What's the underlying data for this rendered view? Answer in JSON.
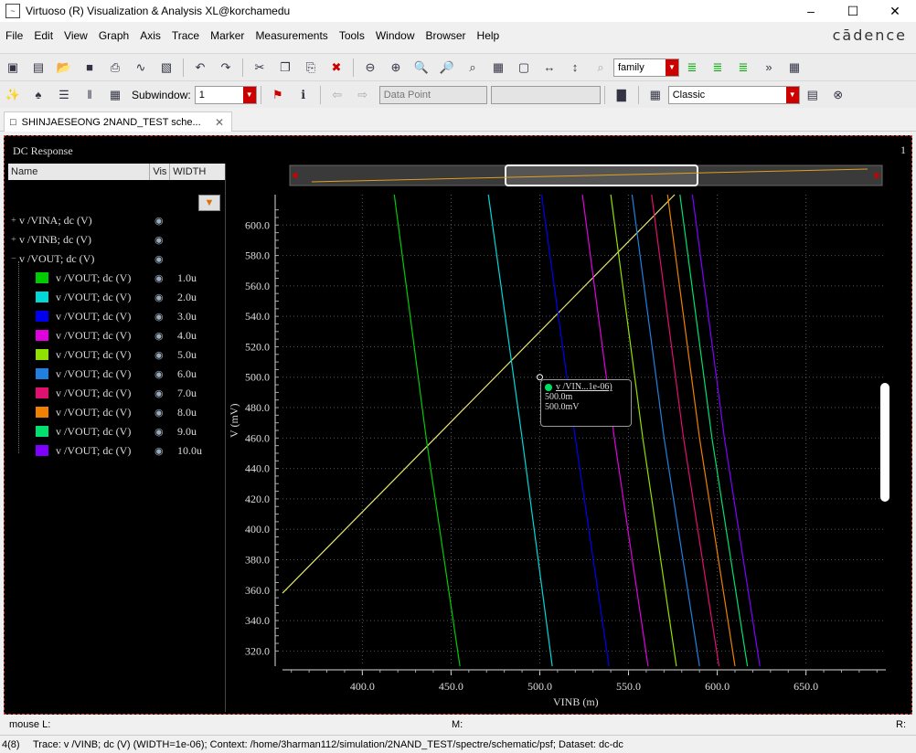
{
  "window": {
    "title": "Virtuoso (R) Visualization & Analysis XL@korchamedu"
  },
  "menu": [
    "File",
    "Edit",
    "View",
    "Graph",
    "Axis",
    "Trace",
    "Marker",
    "Measurements",
    "Tools",
    "Window",
    "Browser",
    "Help"
  ],
  "logo": "cādence",
  "toolbar": {
    "family_value": "family",
    "subwindow_label": "Subwindow:",
    "subwindow_value": "1",
    "data_point_placeholder": "Data Point",
    "style_value": "Classic"
  },
  "tab": {
    "label": "SHINJAESEONG 2NAND_TEST sche..."
  },
  "plot": {
    "title": "DC Response",
    "subwindow_number": "1",
    "ylabel": "V (mV)",
    "xlabel": "VINB (m)"
  },
  "tree": {
    "headers": {
      "name": "Name",
      "vis": "Vis",
      "width": "WIDTH"
    },
    "items": [
      {
        "label": "v /VINA; dc (V)",
        "expander": "+",
        "width": "",
        "color": ""
      },
      {
        "label": "v /VINB; dc (V)",
        "expander": "+",
        "width": "",
        "color": ""
      },
      {
        "label": "v /VOUT; dc (V)",
        "expander": "−",
        "width": "",
        "color": ""
      },
      {
        "label": "v /VOUT; dc (V)",
        "width": "1.0u",
        "color": "#00cc00"
      },
      {
        "label": "v /VOUT; dc (V)",
        "width": "2.0u",
        "color": "#00d8d8"
      },
      {
        "label": "v /VOUT; dc (V)",
        "width": "3.0u",
        "color": "#0000ee"
      },
      {
        "label": "v /VOUT; dc (V)",
        "width": "4.0u",
        "color": "#e000e0"
      },
      {
        "label": "v /VOUT; dc (V)",
        "width": "5.0u",
        "color": "#90e000"
      },
      {
        "label": "v /VOUT; dc (V)",
        "width": "6.0u",
        "color": "#2080e0"
      },
      {
        "label": "v /VOUT; dc (V)",
        "width": "7.0u",
        "color": "#e01070"
      },
      {
        "label": "v /VOUT; dc (V)",
        "width": "8.0u",
        "color": "#f08000"
      },
      {
        "label": "v /VOUT; dc (V)",
        "width": "9.0u",
        "color": "#00e070"
      },
      {
        "label": "v /VOUT; dc (V)",
        "width": "10.0u",
        "color": "#8000ff"
      }
    ]
  },
  "tooltip": {
    "title": "v /VIN...1e-06)",
    "x": "500.0m",
    "y": "500.0mV"
  },
  "chart_data": {
    "type": "line",
    "xlabel": "VINB (m)",
    "ylabel": "V (mV)",
    "xlim": [
      355,
      695
    ],
    "ylim": [
      310,
      620
    ],
    "xticks": [
      400,
      450,
      500,
      550,
      600,
      650
    ],
    "yticks": [
      320,
      340,
      360,
      380,
      400,
      420,
      440,
      460,
      480,
      500,
      520,
      540,
      560,
      580,
      600
    ],
    "series": [
      {
        "name": "v /VINB; dc (V)",
        "color": "#e8e870",
        "points": [
          [
            355,
            358
          ],
          [
            576,
            620
          ]
        ]
      },
      {
        "name": "1.0u",
        "color": "#00cc00",
        "points": [
          [
            418,
            620
          ],
          [
            436,
            460
          ],
          [
            455,
            310
          ]
        ]
      },
      {
        "name": "2.0u",
        "color": "#00d8d8",
        "points": [
          [
            471,
            620
          ],
          [
            490,
            460
          ],
          [
            507,
            310
          ]
        ]
      },
      {
        "name": "3.0u",
        "color": "#0000ee",
        "points": [
          [
            501,
            620
          ],
          [
            520,
            460
          ],
          [
            539,
            310
          ]
        ]
      },
      {
        "name": "4.0u",
        "color": "#e000e0",
        "points": [
          [
            524,
            620
          ],
          [
            542,
            460
          ],
          [
            561,
            310
          ]
        ]
      },
      {
        "name": "5.0u",
        "color": "#90e000",
        "points": [
          [
            540,
            620
          ],
          [
            558,
            460
          ],
          [
            577,
            310
          ]
        ]
      },
      {
        "name": "6.0u",
        "color": "#2080e0",
        "points": [
          [
            552,
            620
          ],
          [
            570,
            460
          ],
          [
            590,
            310
          ]
        ]
      },
      {
        "name": "7.0u",
        "color": "#e01070",
        "points": [
          [
            563,
            620
          ],
          [
            581,
            460
          ],
          [
            601,
            310
          ]
        ]
      },
      {
        "name": "8.0u",
        "color": "#f08000",
        "points": [
          [
            572,
            620
          ],
          [
            590,
            460
          ],
          [
            610,
            310
          ]
        ]
      },
      {
        "name": "9.0u",
        "color": "#00e070",
        "points": [
          [
            579,
            620
          ],
          [
            597,
            460
          ],
          [
            617,
            310
          ]
        ]
      },
      {
        "name": "10.0u",
        "color": "#8000ff",
        "points": [
          [
            586,
            620
          ],
          [
            604,
            460
          ],
          [
            624,
            310
          ]
        ]
      }
    ]
  },
  "status": {
    "mouse_label": "mouse L:",
    "middle_label": "M:",
    "right_label": "R:",
    "count": "4(8)",
    "trace_info": "Trace: v /VINB; dc (V) (WIDTH=1e-06); Context: /home/3harman112/simulation/2NAND_TEST/spectre/schematic/psf; Dataset: dc-dc"
  }
}
